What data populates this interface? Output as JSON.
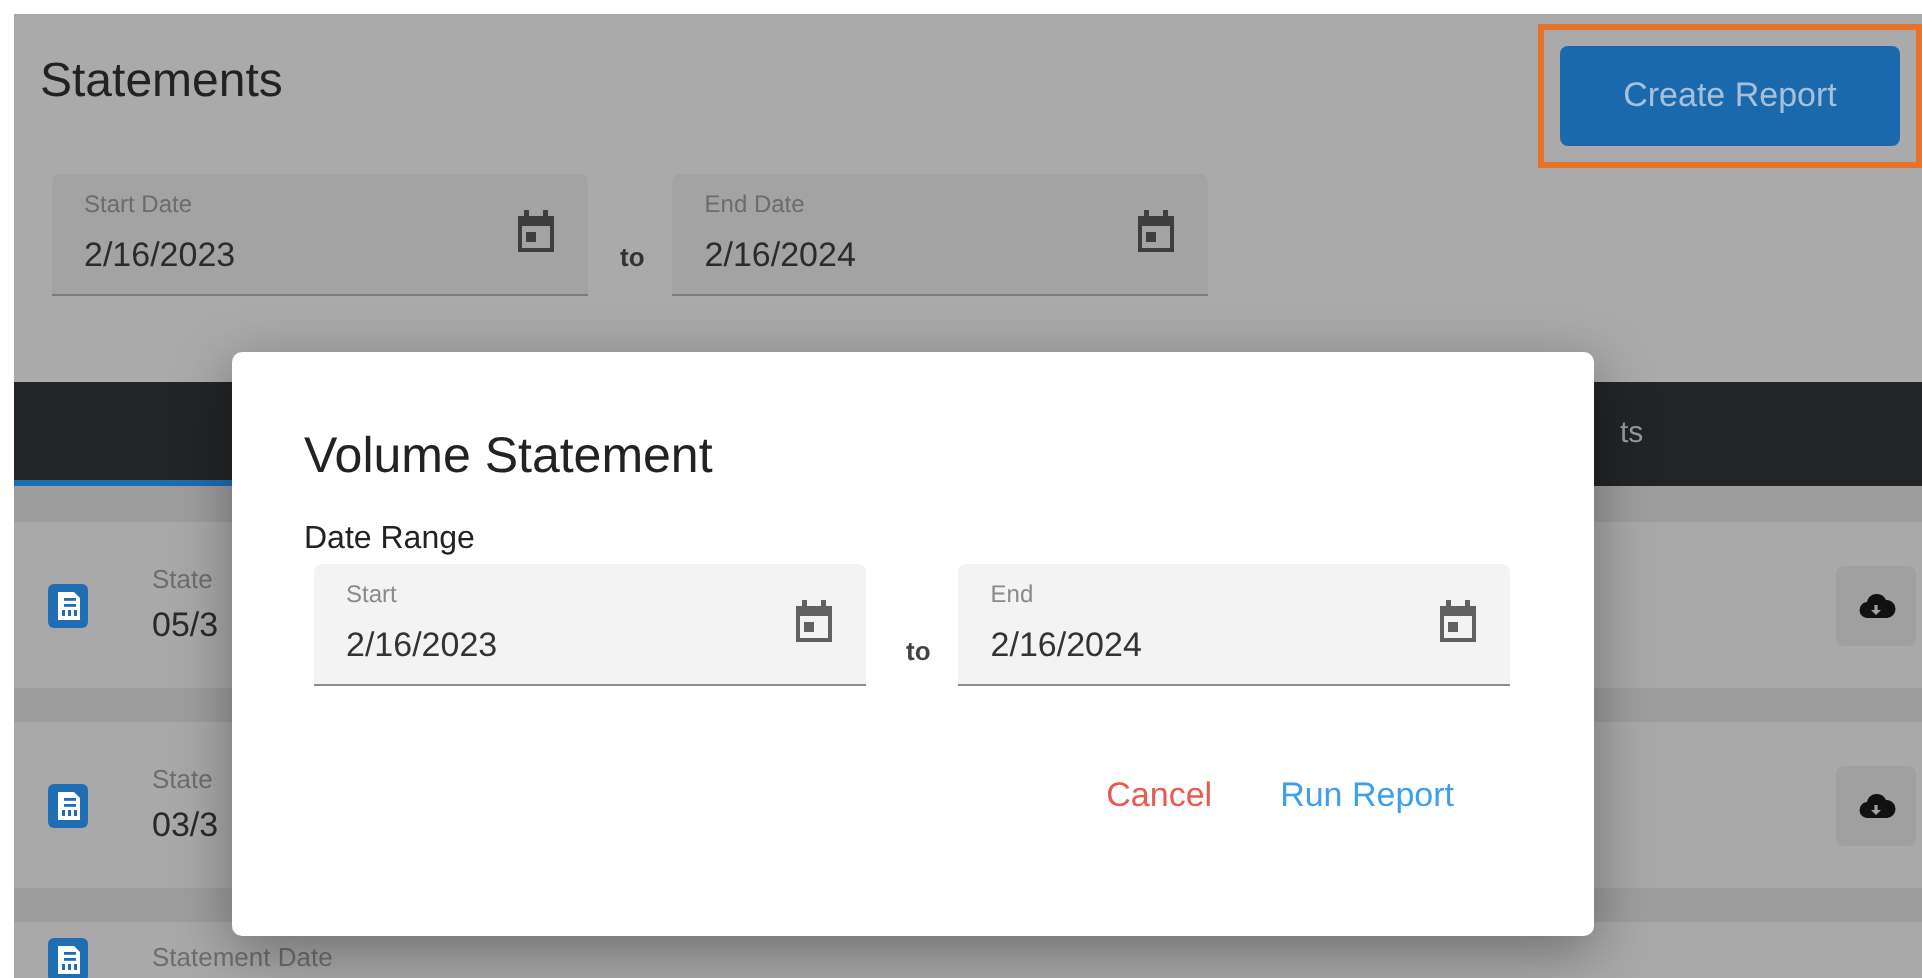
{
  "page": {
    "title": "Statements",
    "create_button": {
      "label": "Create Report",
      "highlighted": true
    },
    "filters": [
      {
        "label": "Start Date",
        "value": "2/16/2023"
      },
      {
        "label": "End Date",
        "value": "2/16/2024"
      }
    ],
    "range_word": "to",
    "tabs": [
      {
        "selected": true
      },
      {
        "label": "ts",
        "selected": false
      }
    ],
    "statements": [
      {
        "label": "State",
        "date": "05/3"
      },
      {
        "label": "State",
        "date": "03/3"
      },
      {
        "label": "Statement Date"
      }
    ]
  },
  "modal": {
    "title": "Volume Statement",
    "section_label": "Date Range",
    "fields": [
      {
        "label": "Start",
        "value": "2/16/2023"
      },
      {
        "label": "End",
        "value": "2/16/2024"
      }
    ],
    "range_word": "to",
    "actions": [
      {
        "label": "Cancel",
        "kind": "cancel"
      },
      {
        "label": "Run Report",
        "kind": "primary"
      }
    ]
  }
}
